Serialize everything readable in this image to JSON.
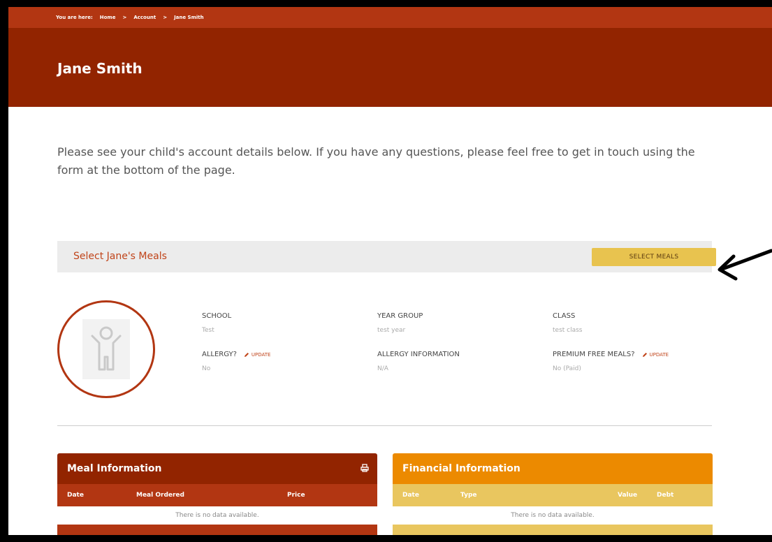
{
  "breadcrumb": {
    "prefix": "You are here:",
    "items": [
      "Home",
      "Account",
      "Jane Smith"
    ],
    "separator": ">"
  },
  "hero": {
    "title": "Jane Smith"
  },
  "intro": "Please see your child's account details below. If you have any questions, please feel free to get in touch using the form at the bottom of the page.",
  "meals_bar": {
    "title": "Select Jane's Meals",
    "button": "SELECT MEALS"
  },
  "profile": {
    "school_label": "SCHOOL",
    "school_value": "Test",
    "year_label": "YEAR GROUP",
    "year_value": "test year",
    "class_label": "CLASS",
    "class_value": "test class",
    "allergy_label": "ALLERGY?",
    "allergy_value": "No",
    "allergy_info_label": "ALLERGY INFORMATION",
    "allergy_info_value": "N/A",
    "premium_label": "PREMIUM FREE MEALS?",
    "premium_value": "No (Paid)",
    "update_label": "UPDATE"
  },
  "meal_panel": {
    "title": "Meal Information",
    "columns": [
      "Date",
      "Meal Ordered",
      "Price"
    ],
    "empty": "There is no data available."
  },
  "fin_panel": {
    "title": "Financial Information",
    "columns": [
      "Date",
      "Type",
      "Value",
      "Debt"
    ],
    "empty": "There is no data available."
  },
  "colors": {
    "brand_dark": "#922400",
    "brand": "#b23612",
    "accent": "#c0441a",
    "button": "#e8c34f",
    "fin_header": "#ec8a00",
    "fin_sub": "#e9c65f"
  },
  "icons": [
    "pencil-icon",
    "child-avatar-icon",
    "print-icon",
    "arrow-icon"
  ]
}
